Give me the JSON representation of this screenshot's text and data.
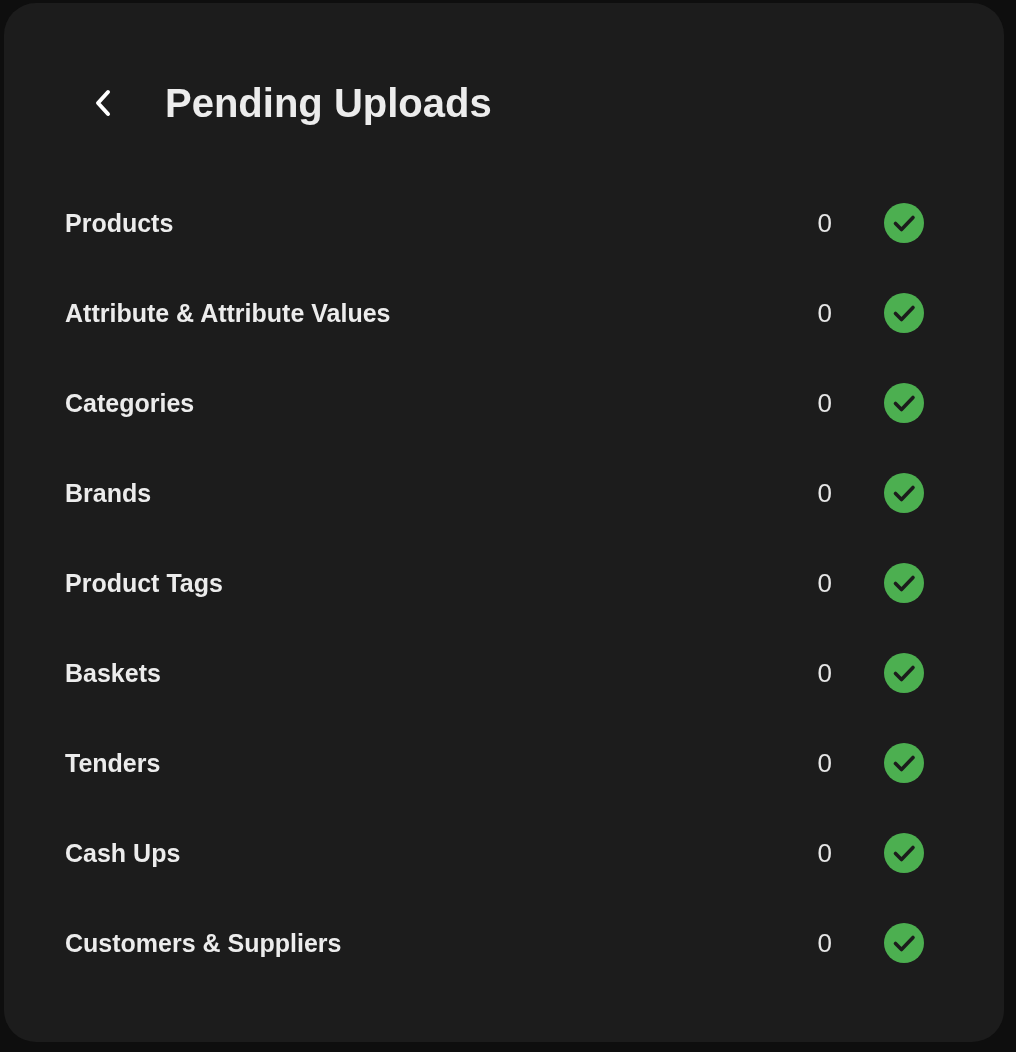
{
  "header": {
    "title": "Pending Uploads"
  },
  "items": [
    {
      "label": "Products",
      "count": "0",
      "done": true
    },
    {
      "label": "Attribute & Attribute Values",
      "count": "0",
      "done": true
    },
    {
      "label": "Categories",
      "count": "0",
      "done": true
    },
    {
      "label": "Brands",
      "count": "0",
      "done": true
    },
    {
      "label": "Product Tags",
      "count": "0",
      "done": true
    },
    {
      "label": "Baskets",
      "count": "0",
      "done": true
    },
    {
      "label": "Tenders",
      "count": "0",
      "done": true
    },
    {
      "label": "Cash Ups",
      "count": "0",
      "done": true
    },
    {
      "label": "Customers & Suppliers",
      "count": "0",
      "done": true
    }
  ]
}
